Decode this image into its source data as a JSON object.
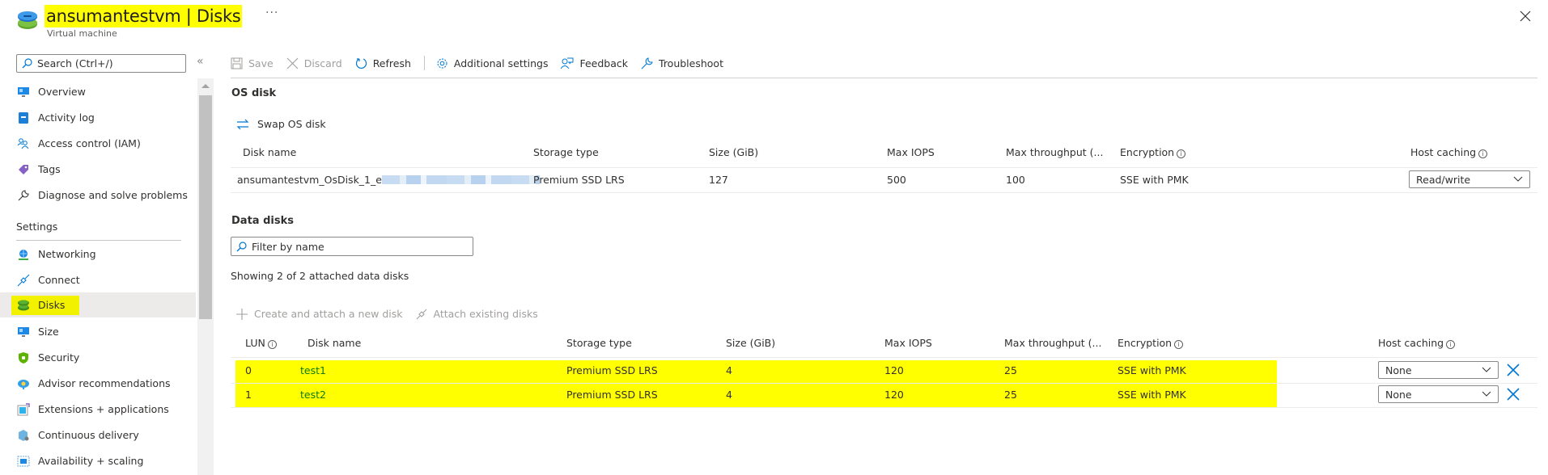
{
  "header": {
    "title": "ansumantestvm | Disks",
    "subtitle": "Virtual machine",
    "more_label": "···",
    "resource_icon": "disk-icon",
    "close_icon": "close-icon"
  },
  "sidebar": {
    "search_placeholder": "Search (Ctrl+/)",
    "collapse_label": "«",
    "items": [
      {
        "label": "Overview",
        "icon": "monitor-icon"
      },
      {
        "label": "Activity log",
        "icon": "activity-log-icon"
      },
      {
        "label": "Access control (IAM)",
        "icon": "people-icon"
      },
      {
        "label": "Tags",
        "icon": "tag-icon"
      },
      {
        "label": "Diagnose and solve problems",
        "icon": "wrench-icon"
      }
    ],
    "settings_header": "Settings",
    "settings_items": [
      {
        "label": "Networking",
        "icon": "networking-icon"
      },
      {
        "label": "Connect",
        "icon": "plug-icon"
      },
      {
        "label": "Disks",
        "icon": "disk-icon",
        "selected": true
      },
      {
        "label": "Size",
        "icon": "monitor-icon"
      },
      {
        "label": "Security",
        "icon": "shield-icon"
      },
      {
        "label": "Advisor recommendations",
        "icon": "advisor-icon"
      },
      {
        "label": "Extensions + applications",
        "icon": "extensions-icon"
      },
      {
        "label": "Continuous delivery",
        "icon": "delivery-icon"
      },
      {
        "label": "Availability + scaling",
        "icon": "scaling-icon"
      }
    ]
  },
  "toolbar": {
    "save": "Save",
    "discard": "Discard",
    "refresh": "Refresh",
    "additional_settings": "Additional settings",
    "feedback": "Feedback",
    "troubleshoot": "Troubleshoot"
  },
  "os_disk": {
    "title": "OS disk",
    "swap_label": "Swap OS disk",
    "columns": [
      "Disk name",
      "Storage type",
      "Size (GiB)",
      "Max IOPS",
      "Max throughput (...",
      "Encryption",
      "Host caching"
    ],
    "row": {
      "disk_name": "ansumantestvm_OsDisk_1_e",
      "storage_type": "Premium SSD LRS",
      "size": "127",
      "max_iops": "500",
      "max_throughput": "100",
      "encryption": "SSE with PMK",
      "host_caching": "Read/write"
    }
  },
  "data_disks": {
    "title": "Data disks",
    "filter_placeholder": "Filter by name",
    "showing_text": "Showing 2 of 2 attached data disks",
    "create_attach_label": "Create and attach a new disk",
    "attach_existing_label": "Attach existing disks",
    "columns": [
      "LUN",
      "Disk name",
      "Storage type",
      "Size (GiB)",
      "Max IOPS",
      "Max throughput (...",
      "Encryption",
      "Host caching"
    ],
    "rows": [
      {
        "lun": "0",
        "disk_name": "test1",
        "storage_type": "Premium SSD LRS",
        "size": "4",
        "max_iops": "120",
        "max_throughput": "25",
        "encryption": "SSE with PMK",
        "host_caching": "None"
      },
      {
        "lun": "1",
        "disk_name": "test2",
        "storage_type": "Premium SSD LRS",
        "size": "4",
        "max_iops": "120",
        "max_throughput": "25",
        "encryption": "SSE with PMK",
        "host_caching": "None"
      }
    ]
  },
  "colors": {
    "accent": "#0078d4",
    "highlight": "#ffff00",
    "link_on_highlight": "#107c10"
  }
}
